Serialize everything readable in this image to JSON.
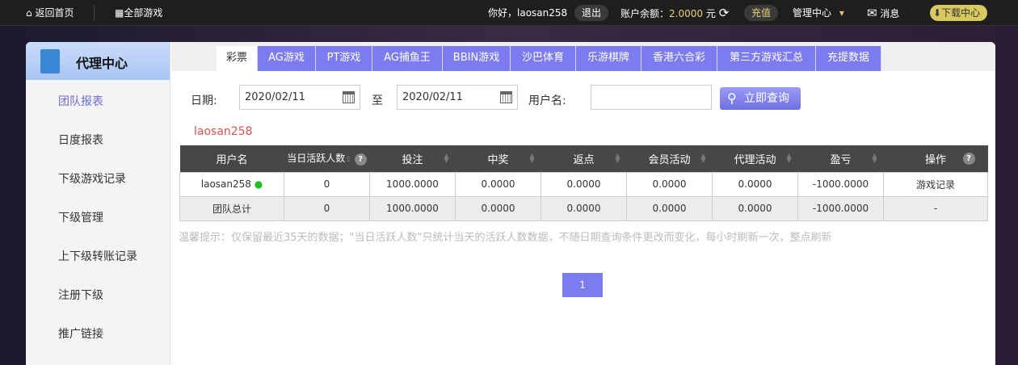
{
  "topbar": {
    "home": "返回首页",
    "all_games": "全部游戏",
    "greeting": "你好，laosan258",
    "logout": "退出",
    "balance_label": "账户余额：",
    "balance": "2.0000",
    "currency": "元",
    "recharge": "充值",
    "manage": "管理中心",
    "messages": "消息",
    "download": "下载中心"
  },
  "sidebar": {
    "title": "代理中心",
    "items": [
      "团队报表",
      "日度报表",
      "下级游戏记录",
      "下级管理",
      "上下级转账记录",
      "注册下级",
      "推广链接"
    ]
  },
  "tabs": [
    "彩票",
    "AG游戏",
    "PT游戏",
    "AG捕鱼王",
    "BBIN游戏",
    "沙巴体育",
    "乐游棋牌",
    "香港六合彩",
    "第三方游戏汇总",
    "充提数据"
  ],
  "form": {
    "date_label": "日期:",
    "date_from": "2020/02/11",
    "to_label": "至",
    "date_to": "2020/02/11",
    "user_label": "用户名:",
    "user_value": "",
    "search": "立即查询"
  },
  "breadcrumb_user": "laosan258",
  "table": {
    "headers": [
      "用户名",
      "当日活跃人数",
      "投注",
      "中奖",
      "返点",
      "会员活动",
      "代理活动",
      "盈亏",
      "操作"
    ],
    "rows": [
      [
        "laosan258",
        "0",
        "1000.0000",
        "0.0000",
        "0.0000",
        "0.0000",
        "0.0000",
        "-1000.0000",
        "游戏记录"
      ],
      [
        "团队总计",
        "0",
        "1000.0000",
        "0.0000",
        "0.0000",
        "0.0000",
        "0.0000",
        "-1000.0000",
        "-"
      ]
    ]
  },
  "hint": "温馨提示：仅保留最近35天的数据；\"当日活跃人数\"只统计当天的活跃人数数据，不随日期查询条件更改而变化，每小时刷新一次，整点刷新",
  "pager": {
    "current": "1"
  },
  "colors": {
    "accent": "#7c7cf0",
    "header_dark": "#474747",
    "online": "#22c022"
  }
}
